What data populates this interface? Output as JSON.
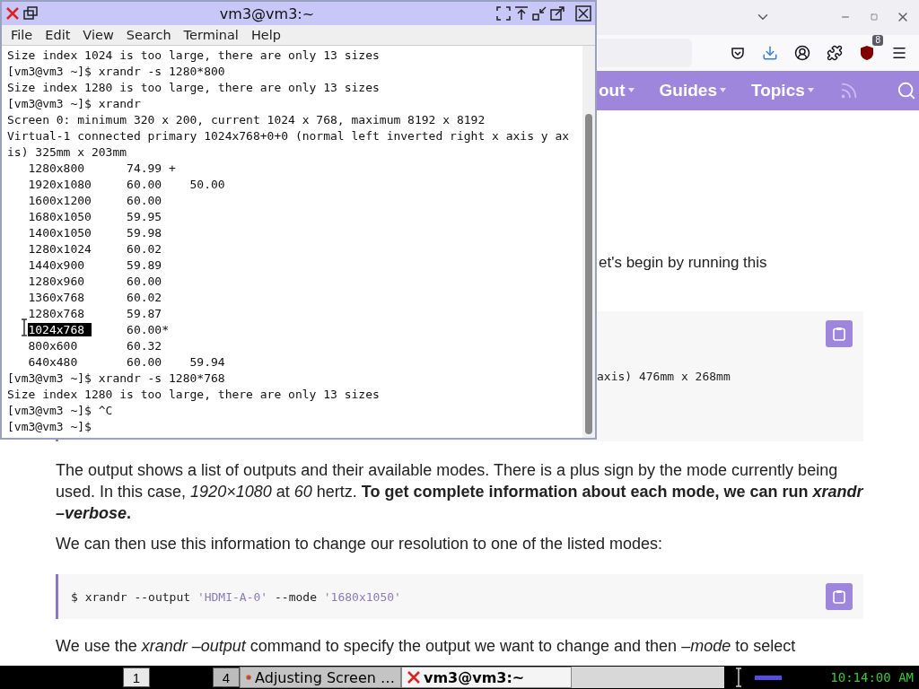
{
  "terminal": {
    "title": "vm3@vm3:~",
    "menu": [
      "File",
      "Edit",
      "View",
      "Search",
      "Terminal",
      "Help"
    ],
    "lines": [
      {
        "text": "Size index 1024 is too large, there are only 13 sizes"
      },
      {
        "text": "[vm3@vm3 ~]$ xrandr -s 1280*800"
      },
      {
        "text": "Size index 1280 is too large, there are only 13 sizes"
      },
      {
        "text": "[vm3@vm3 ~]$ xrandr"
      },
      {
        "text": "Screen 0: minimum 320 x 200, current 1024 x 768, maximum 8192 x 8192"
      },
      {
        "text": "Virtual-1 connected primary 1024x768+0+0 (normal left inverted right x axis y ax"
      },
      {
        "text": "is) 325mm x 203mm"
      },
      {
        "text": "   1280x800      74.99 +"
      },
      {
        "text": "   1920x1080     60.00    50.00"
      },
      {
        "text": "   1600x1200     60.00"
      },
      {
        "text": "   1680x1050     59.95"
      },
      {
        "text": "   1400x1050     59.98"
      },
      {
        "text": "   1280x1024     60.02"
      },
      {
        "text": "   1440x900      59.89"
      },
      {
        "text": "   1280x960      60.00"
      },
      {
        "text": "   1360x768      60.02"
      },
      {
        "text": "   1280x768      59.87"
      },
      {
        "parts": [
          {
            "text": "1024x768 ",
            "selected": true
          },
          {
            "text": "     60.00*",
            "selected": false
          }
        ]
      },
      {
        "text": "   800x600       60.32"
      },
      {
        "text": "   640x480       60.00    59.94"
      },
      {
        "text": "[vm3@vm3 ~]$ xrandr -s 1280*768"
      },
      {
        "text": "Size index 1280 is too large, there are only 13 sizes"
      },
      {
        "text": "[vm3@vm3 ~]$ ^C"
      },
      {
        "text": "[vm3@vm3 ~]$"
      }
    ]
  },
  "browser": {
    "extension_badge": "8",
    "nav": [
      {
        "label": "out"
      },
      {
        "label": "Guides"
      },
      {
        "label": "Topics"
      }
    ],
    "article": [
      {
        "kind": "covered_text",
        "text": "et's begin by running this"
      },
      {
        "kind": "covered_code",
        "tokens": [
          {
            "kind": "plain",
            "text": "axis) 476mm x 268mm"
          }
        ]
      },
      {
        "kind": "paragraph",
        "text": "The output shows a list of outputs and their available modes. There is a plus sign by the mode currently being used. In this case, *1920×1080* at *60* hertz. **To get complete information about each mode, we can run *xrandr –verbose*.**"
      },
      {
        "kind": "paragraph",
        "text": "We can then use this information to change our resolution to one of the listed modes:"
      },
      {
        "kind": "code",
        "tokens": [
          {
            "kind": "plain",
            "text": "$ xrandr --output "
          },
          {
            "kind": "string",
            "text": "'HDMI-A-0'"
          },
          {
            "kind": "plain",
            "text": " --mode "
          },
          {
            "kind": "string",
            "text": "'1680x1050'"
          }
        ]
      },
      {
        "kind": "paragraph",
        "text": "We use the *xrandr –output* command to specify the output we want to change and then *–mode* to select"
      }
    ]
  },
  "taskbar": {
    "workspaces": [
      {
        "label": "1",
        "selected": true
      },
      {
        "label": "4",
        "selected": false
      }
    ],
    "tasks": [
      {
        "label": "Adjusting Screen …",
        "kind": "browser",
        "selected": false
      },
      {
        "label": "vm3@vm3:~",
        "kind": "terminal",
        "selected": true
      }
    ],
    "clock": "10:14:00 AM"
  }
}
